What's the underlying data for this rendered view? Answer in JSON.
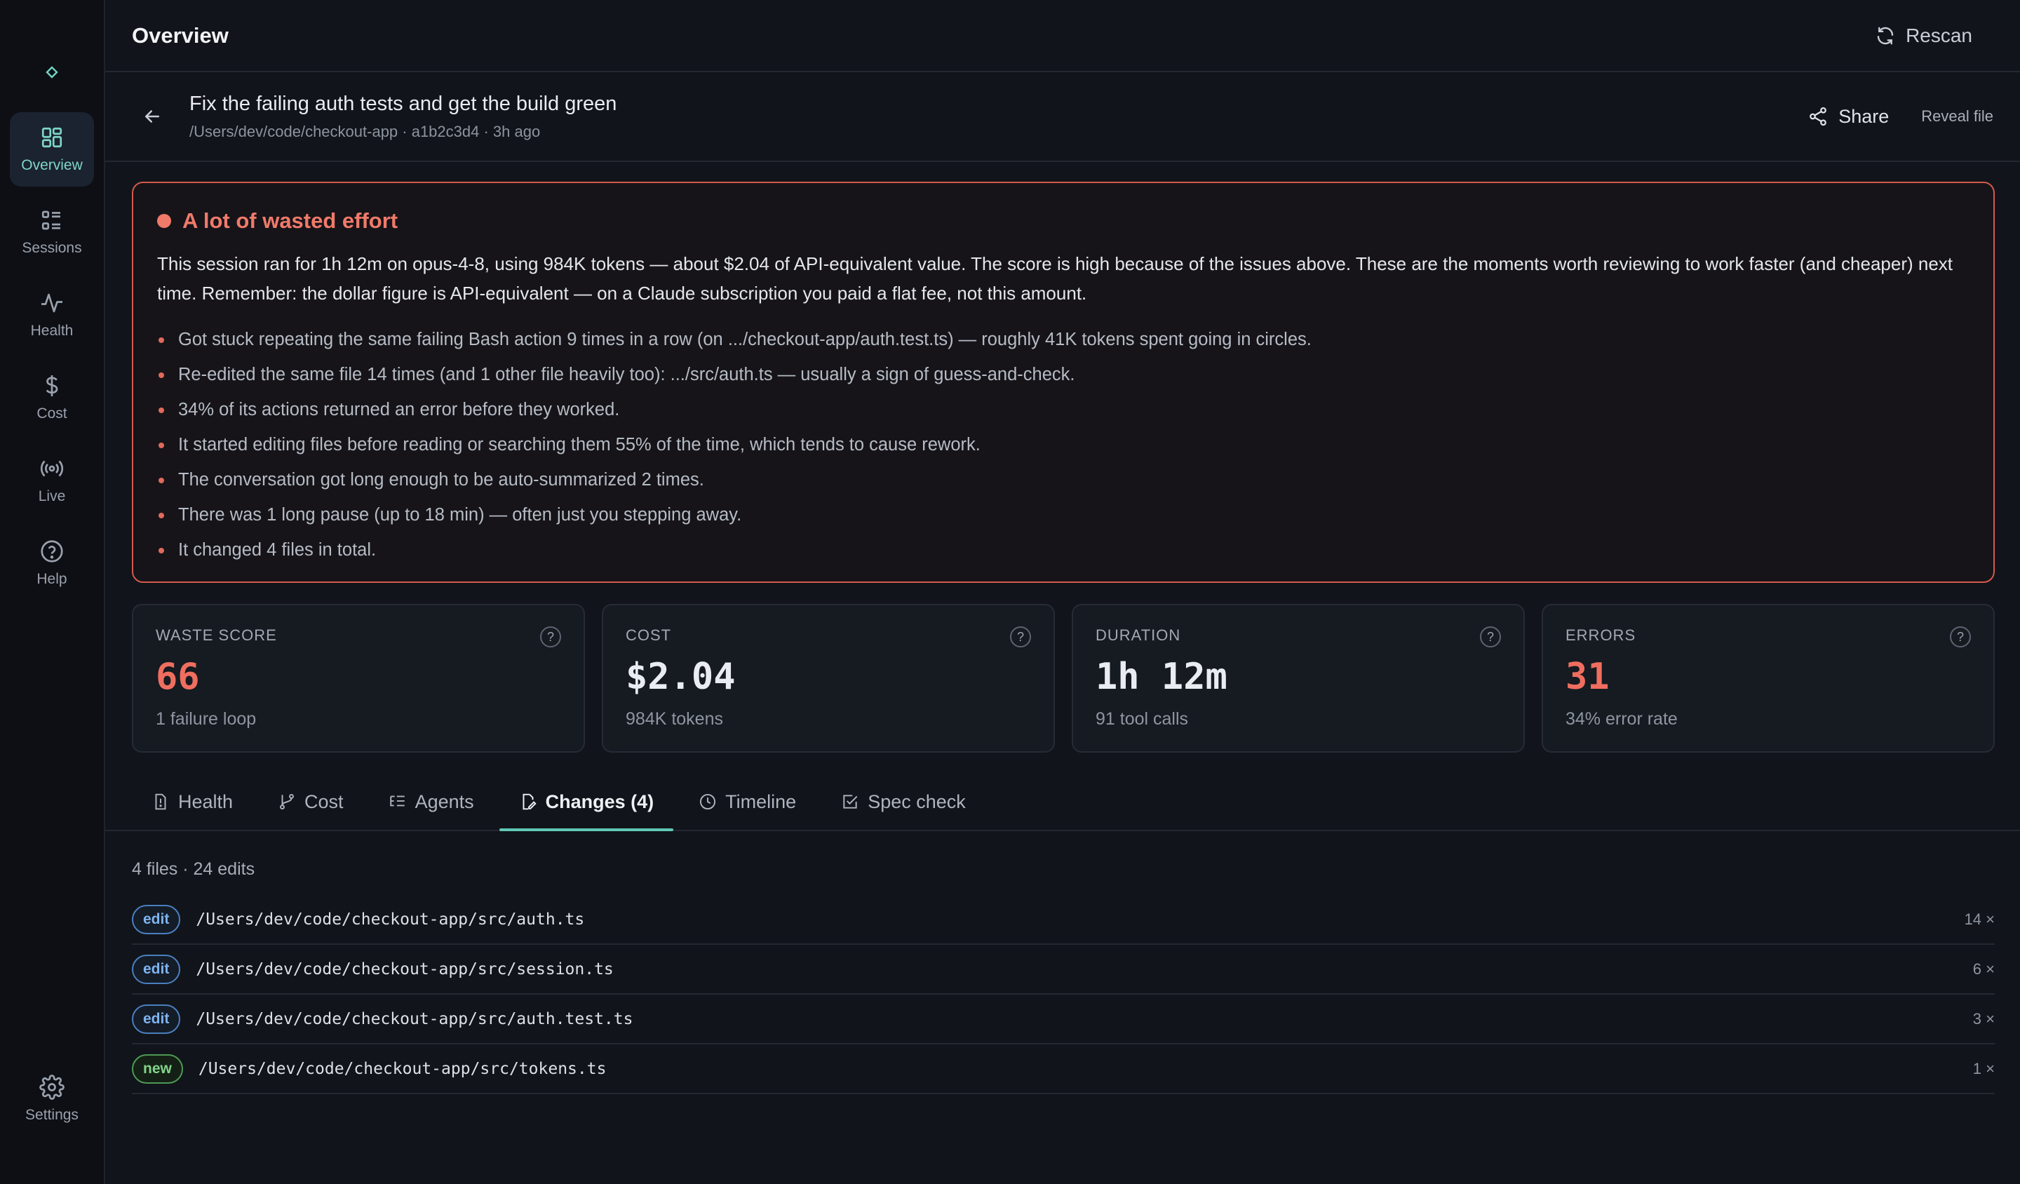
{
  "sidebar": {
    "items": [
      {
        "label": "Overview",
        "icon": "grid-icon",
        "active": true
      },
      {
        "label": "Sessions",
        "icon": "list-icon"
      },
      {
        "label": "Health",
        "icon": "pulse-icon"
      },
      {
        "label": "Cost",
        "icon": "dollar-icon"
      },
      {
        "label": "Live",
        "icon": "broadcast-icon"
      },
      {
        "label": "Help",
        "icon": "help-icon"
      }
    ],
    "settings_label": "Settings"
  },
  "header": {
    "title": "Overview",
    "rescan_label": "Rescan"
  },
  "session": {
    "title": "Fix the failing auth tests and get the build green",
    "subtitle": "/Users/dev/code/checkout-app · a1b2c3d4 · 3h ago",
    "share_label": "Share",
    "reveal_label": "Reveal file"
  },
  "alert": {
    "title": "A lot of wasted effort",
    "color": "#f07a6a",
    "body": "This session ran for 1h 12m on opus-4-8, using 984K tokens — about $2.04 of API-equivalent value. The score is high because of the issues above. These are the moments worth reviewing to work faster (and cheaper) next time. Remember: the dollar figure is API-equivalent — on a Claude subscription you paid a flat fee, not this amount.",
    "bullets": [
      "Got stuck repeating the same failing Bash action 9 times in a row (on .../checkout-app/auth.test.ts) — roughly 41K tokens spent going in circles.",
      "Re-edited the same file 14 times (and 1 other file heavily too): .../src/auth.ts — usually a sign of guess-and-check.",
      "34% of its actions returned an error before they worked.",
      "It started editing files before reading or searching them 55% of the time, which tends to cause rework.",
      "The conversation got long enough to be auto-summarized 2 times.",
      "There was 1 long pause (up to 18 min) — often just you stepping away.",
      "It changed 4 files in total."
    ]
  },
  "cards": [
    {
      "label": "WASTE SCORE",
      "value": "66",
      "sub": "1 failure loop",
      "accent": true
    },
    {
      "label": "COST",
      "value": "$2.04",
      "sub": "984K tokens",
      "accent": false
    },
    {
      "label": "DURATION",
      "value": "1h 12m",
      "sub": "91 tool calls",
      "accent": false
    },
    {
      "label": "ERRORS",
      "value": "31",
      "sub": "34% error rate",
      "accent": true
    }
  ],
  "tabs": [
    {
      "label": "Health",
      "icon": "alert-doc-icon"
    },
    {
      "label": "Cost",
      "icon": "branch-icon"
    },
    {
      "label": "Agents",
      "icon": "tree-list-icon"
    },
    {
      "label": "Changes (4)",
      "icon": "file-edit-icon",
      "active": true
    },
    {
      "label": "Timeline",
      "icon": "clock-icon"
    },
    {
      "label": "Spec check",
      "icon": "check-square-icon"
    }
  ],
  "changes": {
    "summary": "4 files · 24 edits",
    "rows": [
      {
        "badge": "edit",
        "path": "/Users/dev/code/checkout-app/src/auth.ts",
        "count": "14 ×"
      },
      {
        "badge": "edit",
        "path": "/Users/dev/code/checkout-app/src/session.ts",
        "count": "6 ×"
      },
      {
        "badge": "edit",
        "path": "/Users/dev/code/checkout-app/src/auth.test.ts",
        "count": "3 ×"
      },
      {
        "badge": "new",
        "path": "/Users/dev/code/checkout-app/src/tokens.ts",
        "count": "1 ×"
      }
    ]
  }
}
